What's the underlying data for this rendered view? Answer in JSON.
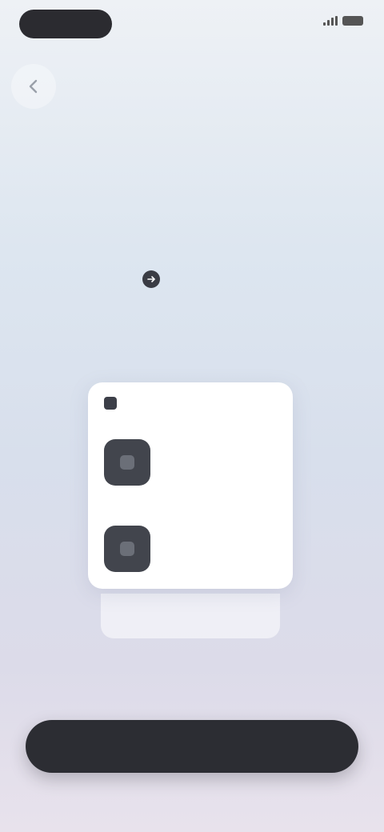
{
  "status_bar": {
    "time": "",
    "icons": [
      "signal-icon",
      "battery-icon"
    ]
  },
  "header": {
    "back_icon": "chevron-left-icon"
  },
  "main": {
    "title": "",
    "subtitle": "",
    "callout_label": "",
    "hint": ""
  },
  "card": {
    "header_label": "",
    "rows": [
      {
        "icon": "app-icon",
        "title": "",
        "subtitle": ""
      },
      {
        "icon": "app-icon",
        "title": "",
        "subtitle": ""
      }
    ]
  },
  "cta": {
    "label": ""
  },
  "colors": {
    "accent": "#2c2d33",
    "background_top": "#eef1f5",
    "background_bottom": "#e8e2ec"
  }
}
